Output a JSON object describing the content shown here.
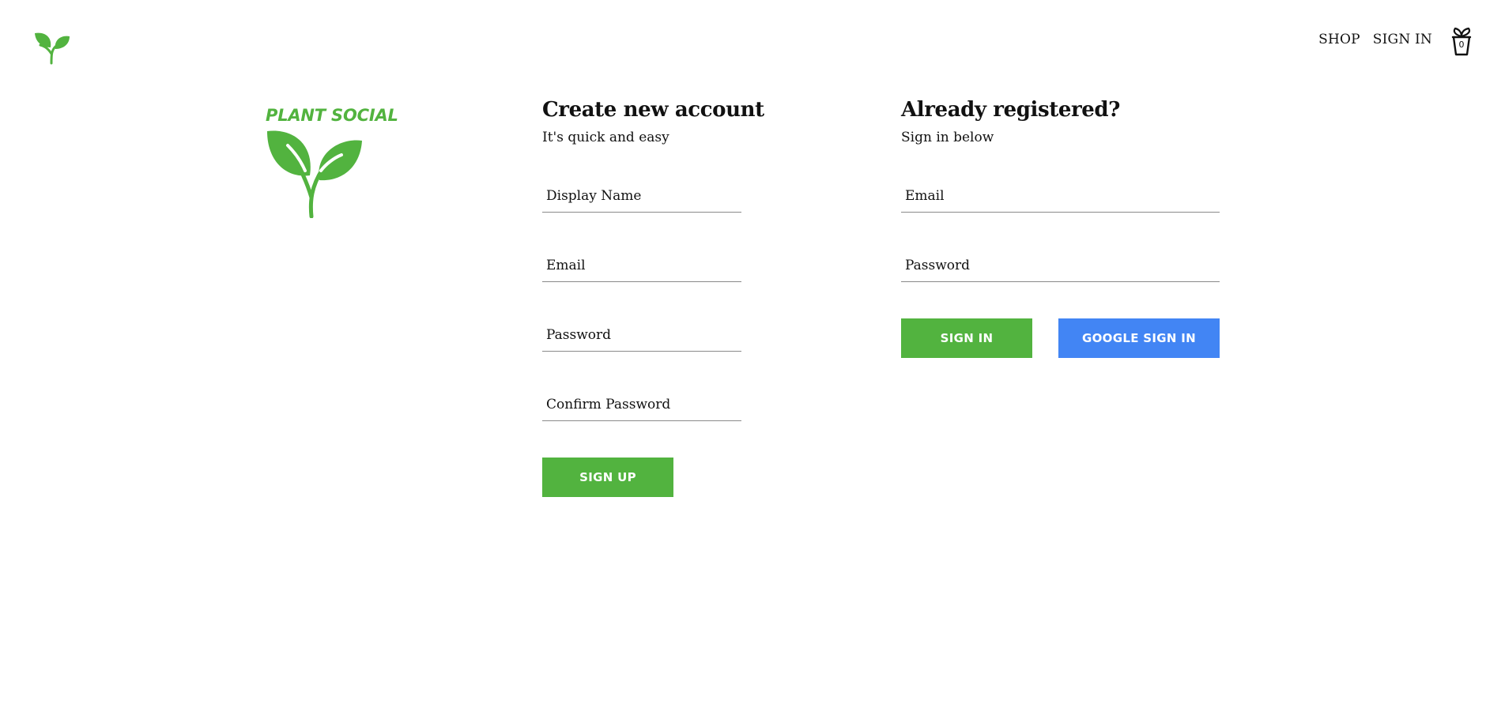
{
  "header": {
    "logo_icon": "sprout-icon",
    "nav": {
      "shop": "SHOP",
      "sign_in": "SIGN IN"
    },
    "cart": {
      "icon": "plant-pot-icon",
      "count": "0"
    }
  },
  "brand": {
    "name": "PLANT SOCIAL",
    "icon": "sprout-icon",
    "color": "#52b33f"
  },
  "signup": {
    "title": "Create new account",
    "subtitle": "It's quick and easy",
    "fields": {
      "display_name": {
        "placeholder": "Display Name",
        "value": ""
      },
      "email": {
        "placeholder": "Email",
        "value": ""
      },
      "password": {
        "placeholder": "Password",
        "value": ""
      },
      "confirm_password": {
        "placeholder": "Confirm Password",
        "value": ""
      }
    },
    "submit_label": "SIGN UP"
  },
  "signin": {
    "title": "Already registered?",
    "subtitle": "Sign in below",
    "fields": {
      "email": {
        "placeholder": "Email",
        "value": ""
      },
      "password": {
        "placeholder": "Password",
        "value": ""
      }
    },
    "submit_label": "SIGN IN",
    "google_label": "GOOGLE SIGN IN"
  },
  "colors": {
    "primary_green": "#52b33f",
    "google_blue": "#4285f4",
    "text": "#111111",
    "divider": "#8a8a8a"
  }
}
